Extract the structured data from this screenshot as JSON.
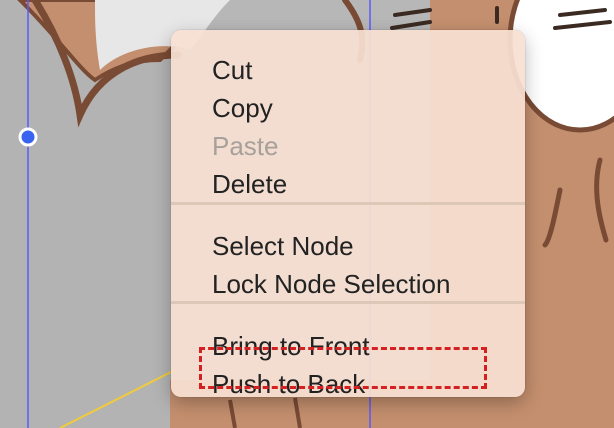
{
  "context_menu": {
    "groups": [
      [
        {
          "label": "Cut",
          "enabled": true
        },
        {
          "label": "Copy",
          "enabled": true
        },
        {
          "label": "Paste",
          "enabled": false
        },
        {
          "label": "Delete",
          "enabled": true
        }
      ],
      [
        {
          "label": "Select Node",
          "enabled": true
        },
        {
          "label": "Lock Node Selection",
          "enabled": true
        }
      ],
      [
        {
          "label": "Bring to Front",
          "enabled": true
        },
        {
          "label": "Push to Back",
          "enabled": true
        }
      ]
    ]
  },
  "annotation": {
    "highlighted_item": "Push to Back",
    "color": "#d42020"
  },
  "colors": {
    "canvas_background": "#b7b7b7",
    "character_fill": "#c48f6e",
    "character_outline": "#7a4b34",
    "guide_line": "#5a5aff",
    "selection_handle": "#3a63f0",
    "curve_line": "#f0cc3a",
    "menu_background": "#f6e0d2"
  }
}
